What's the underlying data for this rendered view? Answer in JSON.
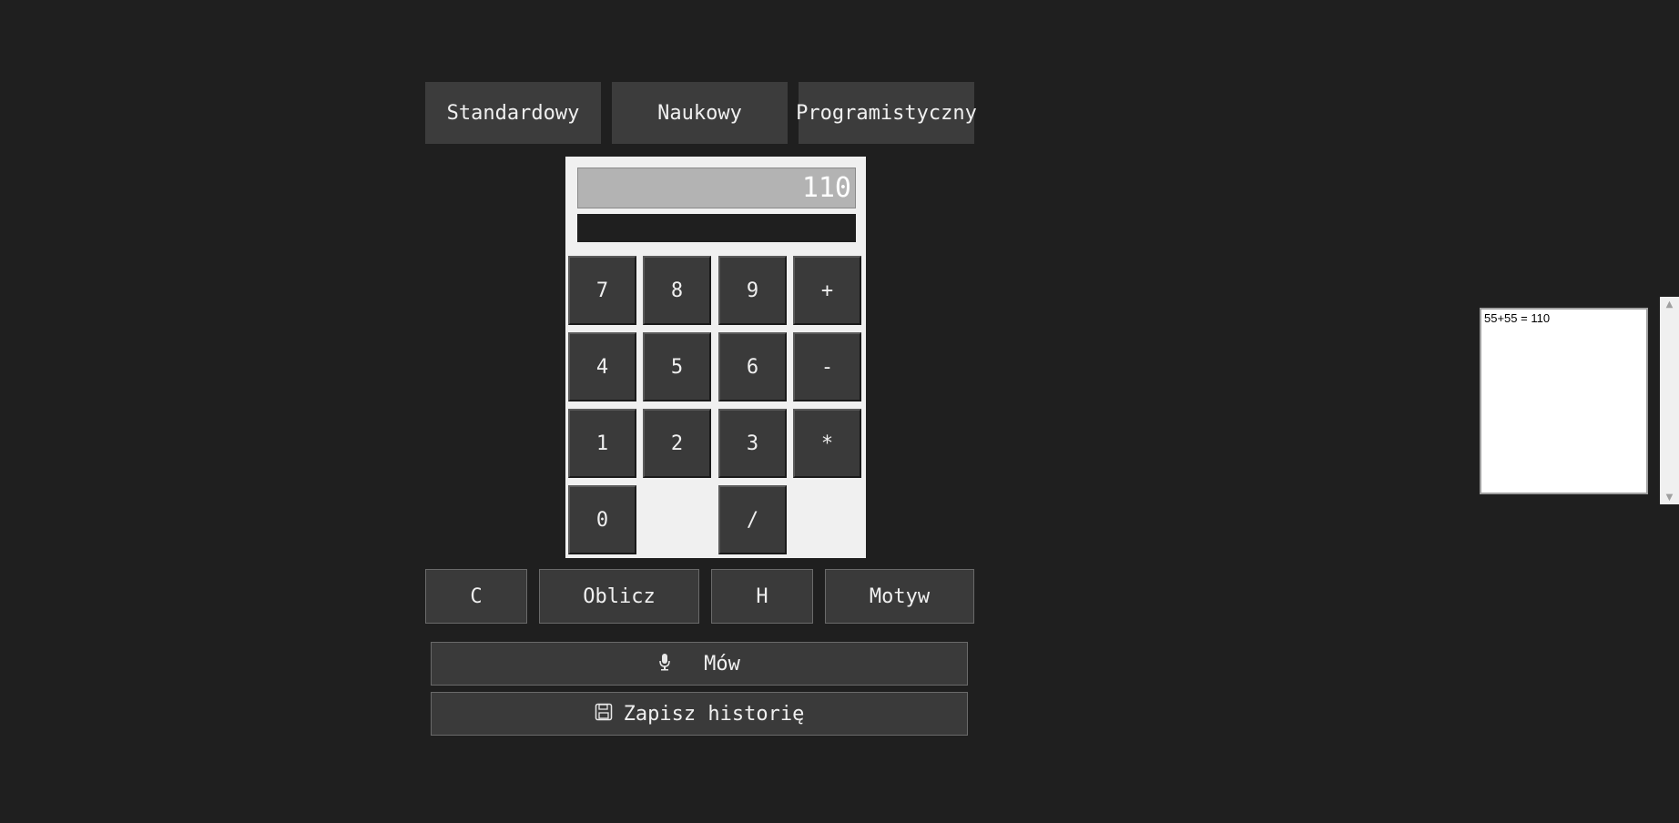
{
  "modes": [
    {
      "label": "Standardowy"
    },
    {
      "label": "Naukowy"
    },
    {
      "label": "Programistyczny"
    }
  ],
  "display": {
    "value": "110",
    "secondary": ""
  },
  "keypad": {
    "keys": [
      "7",
      "8",
      "9",
      "+",
      "4",
      "5",
      "6",
      "-",
      "1",
      "2",
      "3",
      "*",
      "0",
      "/"
    ]
  },
  "actions": {
    "clear": "C",
    "calculate": "Oblicz",
    "history": "H",
    "theme": "Motyw"
  },
  "voice": {
    "icon": "microphone-icon",
    "label": "Mów"
  },
  "save_history": {
    "icon": "floppy-disk-icon",
    "label": "Zapisz historię"
  },
  "history_panel": {
    "entries": [
      "55+55 = 110"
    ]
  },
  "colors": {
    "background": "#1f1f1f",
    "button": "#3a3a3a",
    "panel": "#f0f0f0",
    "display": "#b3b3b3"
  }
}
